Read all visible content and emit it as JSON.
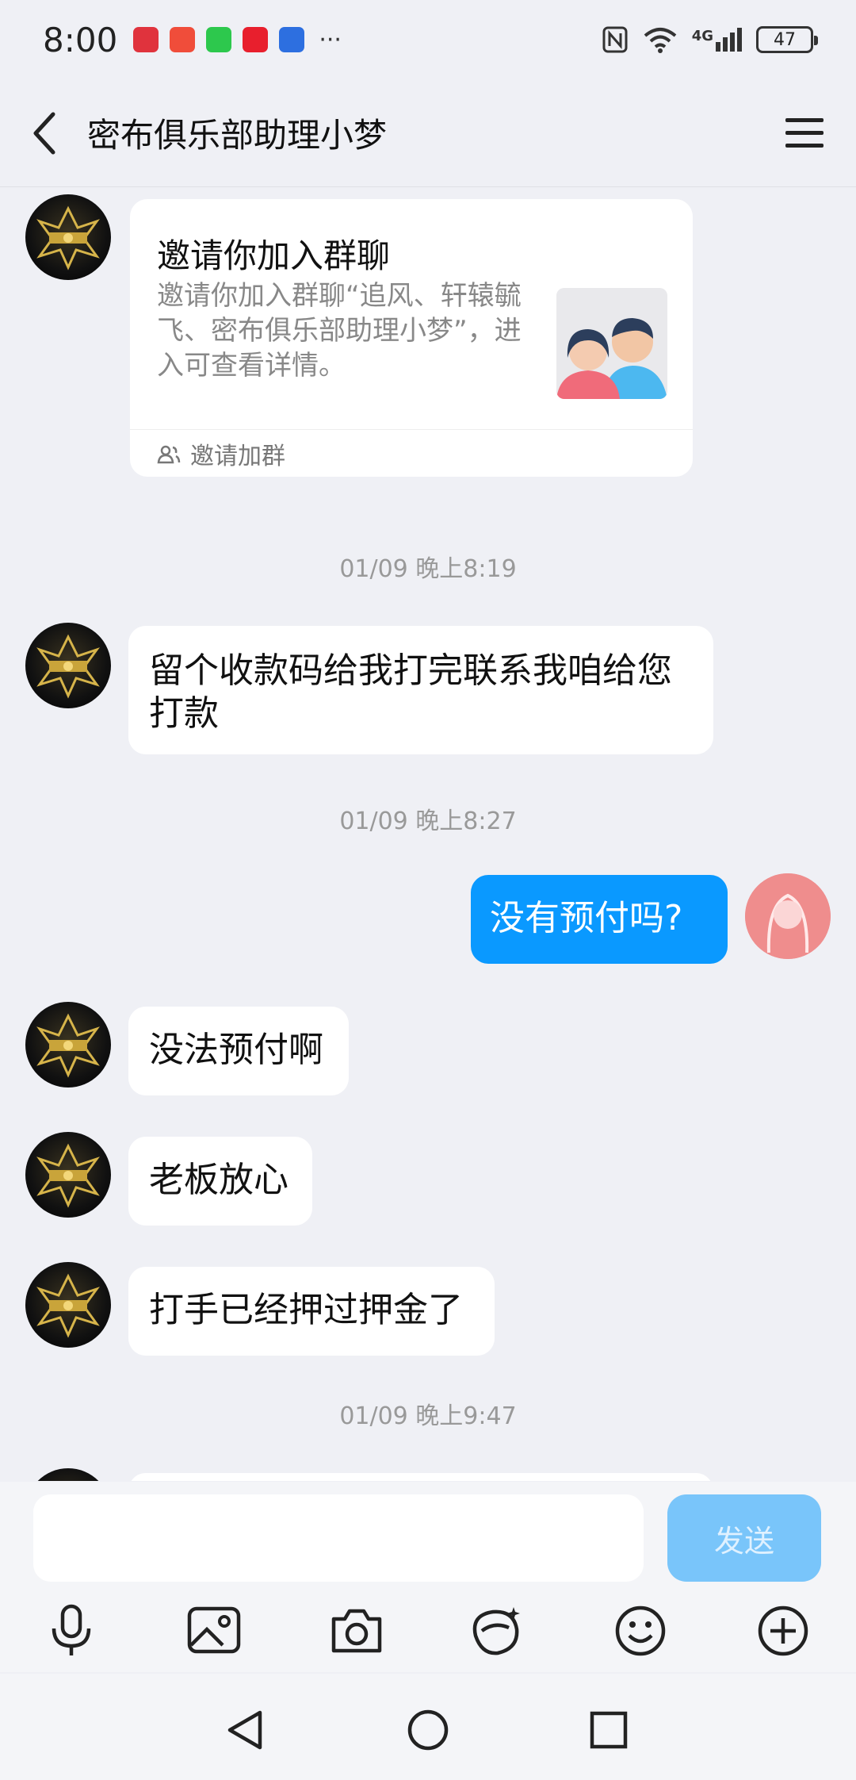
{
  "status_bar": {
    "time": "8:00",
    "more_indicator": "···",
    "network": "4G",
    "battery": "47",
    "app_icons": [
      {
        "name": "huawei-icon",
        "color": "#e0333d"
      },
      {
        "name": "red-app-icon",
        "color": "#f04d3a"
      },
      {
        "name": "wechat-icon",
        "color": "#2dc84d"
      },
      {
        "name": "video-app-icon",
        "color": "#e81f2d"
      },
      {
        "name": "fish-live-icon",
        "color": "#2d6fe0"
      }
    ]
  },
  "header": {
    "title": "密布俱乐部助理小梦",
    "back_icon": "chevron-left-icon",
    "menu_icon": "hamburger-menu-icon"
  },
  "messages": {
    "invite_card": {
      "title": "邀请你加入群聊",
      "description": "邀请你加入群聊“追风、轩辕毓飞、密布俱乐部助理小梦”，进入可查看详情。",
      "footer": "邀请加群"
    },
    "ts1": "01/09 晚上8:19",
    "msg1": "留个收款码给我打完联系我咱给您打款",
    "ts2": "01/09 晚上8:27",
    "msg2": "没有预付吗?",
    "msg3": "没法预付啊",
    "msg4": "老板放心",
    "msg5": "打手已经押过押金了",
    "ts3": "01/09 晚上9:47"
  },
  "input": {
    "value": "",
    "send_label": "发送"
  },
  "toolbar": {
    "icons": [
      "microphone-icon",
      "image-icon",
      "camera-icon",
      "sticker-icon",
      "emoji-icon",
      "plus-icon"
    ]
  },
  "colors": {
    "self_bubble": "#0a99ff",
    "send_button": "#79c5fa",
    "background": "#eff0f5"
  }
}
